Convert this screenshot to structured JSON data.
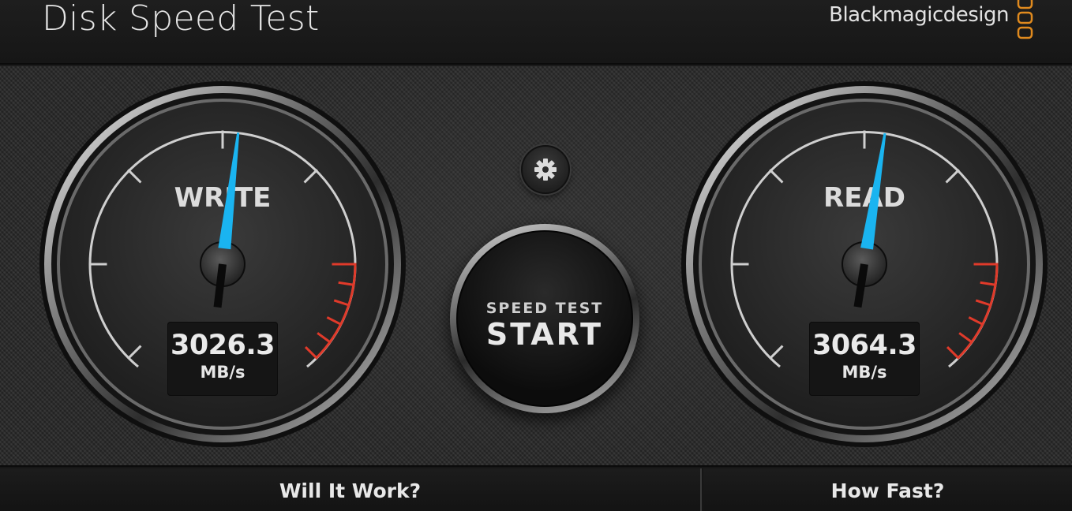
{
  "header": {
    "title": "Disk Speed Test",
    "brand": "Blackmagicdesign"
  },
  "write_gauge": {
    "label": "WRITE",
    "value": "3026.3",
    "unit": "MB/s",
    "needle_fraction": 0.525
  },
  "read_gauge": {
    "label": "READ",
    "value": "3064.3",
    "unit": "MB/s",
    "needle_fraction": 0.533
  },
  "settings": {
    "icon": "gear-icon"
  },
  "start_button": {
    "line1": "SPEED TEST",
    "line2": "START"
  },
  "footer": {
    "left_label": "Will It Work?",
    "right_label": "How Fast?"
  },
  "colors": {
    "needle": "#1ab4f0",
    "redzone": "#e03a2a",
    "brand_logo": "#e08a1e"
  }
}
